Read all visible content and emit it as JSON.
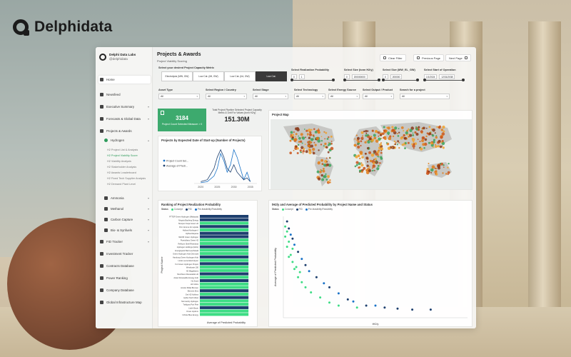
{
  "brand": {
    "name": "Delphidata"
  },
  "sidebar": {
    "org": "Delphi Data Labs",
    "org_sub": "@delphidata",
    "items": [
      {
        "label": "Home",
        "active": true
      },
      {
        "label": "Newsfeed"
      },
      {
        "label": "Executive Summary"
      },
      {
        "label": "Forecasts & Global Data"
      },
      {
        "label": "Projects & Awards"
      },
      {
        "label": "Hydrogen"
      },
      {
        "label": "Ammonia"
      },
      {
        "label": "Methanol"
      },
      {
        "label": "Carbon Capture"
      },
      {
        "label": "Bio- & Synfuels"
      },
      {
        "label": "FID Tracker"
      },
      {
        "label": "Investment Tracker"
      },
      {
        "label": "Contracts Database"
      },
      {
        "label": "Power Ranking"
      },
      {
        "label": "Company Database"
      },
      {
        "label": "Global Infrastructure Map"
      }
    ],
    "sub_items": [
      "H2 Project List & Analysis",
      "H2 Project Viability Score",
      "H2 Viability Analysis",
      "H2 Stakeholder Analysis",
      "H2 Awards Leaderboard",
      "H2 Fixed Tech Supplier Analysis",
      "H2 Demand Plant Level"
    ]
  },
  "header": {
    "title": "Projects & Awards",
    "subtitle": "Project Viability Scoring",
    "clear_filter": "Clear Filter",
    "prev_page": "Previous Page",
    "next_page": "Next Page"
  },
  "filters": {
    "metric_label": "Select your desired Project Capacity Metric",
    "metric_options": [
      "Electrolysis (MW, GW)",
      "Low Cat. (Mt, GW)",
      "Low Cat. (t/d, GW)",
      "Low Cat."
    ],
    "metric_selected_index": 3,
    "realization": {
      "label": "Select Realization Probability",
      "min": "0",
      "max": "1"
    },
    "size_h2": {
      "label": "Select Size (tonn H2/y)",
      "min": "0",
      "max": "200000000"
    },
    "size_mw": {
      "label": "Select Size (MW_EL_GW)",
      "min": "0",
      "max": "200000"
    },
    "start_op": {
      "label": "Select Start of Operation",
      "min": "1/1/2024",
      "max": "12/31/2038"
    },
    "asset_type": {
      "label": "Asset Type",
      "value": "All"
    },
    "region": {
      "label": "Select Region / Country",
      "value": "All"
    },
    "stage": {
      "label": "Select Stage",
      "value": "All"
    },
    "technology": {
      "label": "Select Technology",
      "value": "All"
    },
    "energy_source": {
      "label": "Select Energy Source",
      "value": "All"
    },
    "output": {
      "label": "Select Output / Product",
      "value": "All"
    },
    "search": {
      "label": "Search for a project",
      "placeholder": "All"
    }
  },
  "kpis": {
    "count_value": "3184",
    "count_label": "Project Count Selected Measure > 0",
    "total_title": "Total Project Pipeline Selected Project Capacity Metric & Unit For Values (tonn H2/y)",
    "total_value": "151.30M"
  },
  "cards": {
    "line_title": "Projects by Expected Date of Start-up (Number of Projects)",
    "map_title": "Project Map",
    "bar_title": "Ranking of Project Realization Probability",
    "bar_legend_title": "Status",
    "scatter_title": "tH2/y and Average of Predicted Probability by Project Name and Status",
    "scatter_legend_title": "Status",
    "legend_items": [
      "Concept",
      "FID",
      "Pre-feasibility/Feasibility"
    ],
    "bar_xlabel": "Average of Predicted Probability",
    "bar_ylabel": "Project Name",
    "scatter_xlabel": "tH2/y",
    "scatter_ylabel": "Average of Predicted Probability"
  },
  "colors": {
    "accent": "#3daa6e",
    "green": "#3ddc84",
    "navy": "#1d3f6e",
    "blue": "#1a73c8"
  },
  "chart_data": [
    {
      "type": "line",
      "title": "Projects by Expected Date of Start-up (Number of Projects)",
      "x": [
        2020,
        2022,
        2024,
        2025,
        2026,
        2027,
        2028,
        2029,
        2030,
        2031,
        2032,
        2033,
        2034,
        2035
      ],
      "xlim": [
        2018,
        2037
      ],
      "xticks": [
        "2020",
        "2025",
        "2030",
        "2035"
      ],
      "series": [
        {
          "name": "Project Count Sel...",
          "values": [
            2,
            5,
            20,
            40,
            80,
            60,
            30,
            50,
            90,
            70,
            40,
            10,
            30,
            5
          ]
        },
        {
          "name": "Average of Predi...",
          "values": [
            5,
            10,
            40,
            70,
            90,
            70,
            40,
            30,
            50,
            30,
            20,
            10,
            15,
            5
          ]
        }
      ]
    },
    {
      "type": "bar",
      "title": "Ranking of Project Realization Probability",
      "xlabel": "Average of Predicted Probability",
      "ylabel": "Project Name",
      "categories": [
        "PTTEP Green Hydrogen (Malaysia)",
        "Ningxia Baofeng Energy",
        "Sinopec Kuqa Green H2",
        "Port Jerome Air Liquide",
        "Holland Hydrogen I",
        "HyDeal Espana",
        "NEOM Green Hydrogen",
        "Puertollano Green H2",
        "Refhyne Shell Rheinland",
        "Hydrogen Holdings (HHG)",
        "Energiepark Bad Lauchstadt",
        "Green Hydrogen Hub Denmark",
        "Hamburg Green Hydrogen Hub",
        "Linde Leuna Electrolyser",
        "Yuri Green Hydrogen Project",
        "Westkuste 100",
        "H2 Magallanes",
        "Murchison Renewable H2",
        "Asian Renewable Energy Hub",
        "Hy Stock",
        "H2 Cobra",
        "Arcelor Mittal Bremen",
        "Element Eins",
        "Get H2 Nukleus",
        "HyNet North West",
        "Normandy Hydrogen",
        "Trafigura Port Pirie",
        "Lhyfe Bouin",
        "Oman Hydrom",
        "Infinite Blue Energy"
      ],
      "series": [
        {
          "name": "Concept",
          "values": [
            0.92,
            0.92,
            0.92,
            0.92,
            0.92,
            0.92,
            0.92,
            0.92,
            0.92,
            0.92,
            0.92,
            0.92,
            0.92,
            0.92,
            0.92,
            0.92,
            0.92,
            0.92,
            0.92,
            0.92,
            0.92,
            0.92,
            0.92,
            0.92,
            0.92,
            0.92,
            0.92,
            0.92,
            0.92,
            0.92
          ]
        }
      ],
      "status": [
        "FID",
        "FID",
        "Concept",
        "FID",
        "Concept",
        "FID",
        "FID",
        "Concept",
        "Concept",
        "FID",
        "Concept",
        "Concept",
        "FID",
        "Concept",
        "FID",
        "Concept",
        "Concept",
        "FID",
        "Concept",
        "FID",
        "Concept",
        "Concept",
        "FID",
        "Concept",
        "FID",
        "Concept",
        "Concept",
        "FID",
        "Concept",
        "Concept"
      ]
    },
    {
      "type": "scatter",
      "title": "tH2/y and Average of Predicted Probability by Project Name and Status",
      "xlabel": "tH2/y",
      "ylabel": "Average of Predicted Probability",
      "series": [
        {
          "name": "Concept",
          "points": [
            [
              0.01,
              0.9
            ],
            [
              0.02,
              0.85
            ],
            [
              0.01,
              0.8
            ],
            [
              0.03,
              0.75
            ],
            [
              0.02,
              0.7
            ],
            [
              0.04,
              0.62
            ],
            [
              0.05,
              0.55
            ],
            [
              0.06,
              0.48
            ],
            [
              0.08,
              0.4
            ],
            [
              0.1,
              0.35
            ],
            [
              0.12,
              0.3
            ],
            [
              0.15,
              0.25
            ],
            [
              0.2,
              0.2
            ],
            [
              0.25,
              0.15
            ],
            [
              0.3,
              0.12
            ],
            [
              0.4,
              0.1
            ],
            [
              0.05,
              0.68
            ],
            [
              0.03,
              0.6
            ],
            [
              0.07,
              0.5
            ],
            [
              0.09,
              0.45
            ]
          ]
        },
        {
          "name": "FID",
          "points": [
            [
              0.02,
              0.95
            ],
            [
              0.03,
              0.88
            ],
            [
              0.05,
              0.78
            ],
            [
              0.08,
              0.65
            ],
            [
              0.12,
              0.52
            ],
            [
              0.18,
              0.4
            ],
            [
              0.25,
              0.3
            ],
            [
              0.35,
              0.18
            ],
            [
              0.45,
              0.12
            ],
            [
              0.55,
              0.1
            ],
            [
              0.62,
              0.09
            ],
            [
              0.7,
              0.08
            ],
            [
              0.8,
              0.08
            ]
          ]
        },
        {
          "name": "Pre-feasibility/Feasibility",
          "points": [
            [
              0.04,
              0.82
            ],
            [
              0.06,
              0.72
            ],
            [
              0.1,
              0.58
            ],
            [
              0.14,
              0.46
            ],
            [
              0.22,
              0.34
            ],
            [
              0.3,
              0.24
            ],
            [
              0.38,
              0.16
            ],
            [
              0.5,
              0.12
            ]
          ]
        }
      ]
    }
  ]
}
